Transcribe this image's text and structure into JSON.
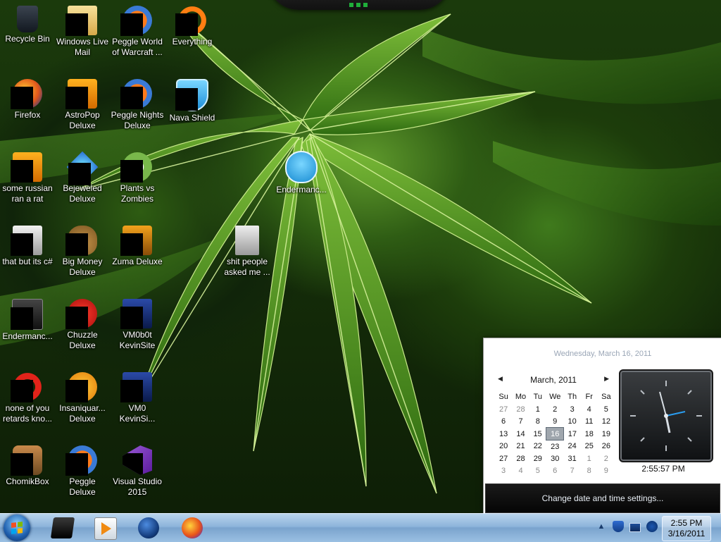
{
  "desktop": {
    "icons": [
      {
        "label": "Recycle Bin",
        "icon": "recycle-bin-icon"
      },
      {
        "label": "Windows Live\nMail",
        "icon": "windows-live-mail-icon"
      },
      {
        "label": "Peggle World\nof Warcraft ...",
        "icon": "peggle-wow-icon"
      },
      {
        "label": "Everything",
        "icon": "everything-icon"
      },
      {
        "label": "Firefox",
        "icon": "firefox-icon"
      },
      {
        "label": "AstroPop\nDeluxe",
        "icon": "astropop-icon"
      },
      {
        "label": "Peggle Nights\nDeluxe",
        "icon": "peggle-nights-icon"
      },
      {
        "label": "Nava Shield",
        "icon": "nava-shield-icon"
      },
      {
        "label": "some russian\nran a rat",
        "icon": "text-document-icon"
      },
      {
        "label": "Bejeweled\nDeluxe",
        "icon": "bejeweled-icon"
      },
      {
        "label": "Plants vs\nZombies",
        "icon": "plants-vs-zombies-icon"
      },
      {
        "label": "Endermanc...",
        "icon": "enderman-shield-icon"
      },
      {
        "label": "that but its c#",
        "icon": "stacked-documents-icon"
      },
      {
        "label": "Big Money\nDeluxe",
        "icon": "big-money-icon"
      },
      {
        "label": "Zuma Deluxe",
        "icon": "zuma-icon"
      },
      {
        "label": "shit people\nasked me ...",
        "icon": "folder-document-icon"
      },
      {
        "label": "Endermanc...",
        "icon": "text-file-icon"
      },
      {
        "label": "Chuzzle\nDeluxe",
        "icon": "chuzzle-icon"
      },
      {
        "label": "VM0b0t\nKevinSite",
        "icon": "vm-site-icon"
      },
      {
        "label": "none of you\nretards kno...",
        "icon": "opera-icon"
      },
      {
        "label": "Insaniquar...\nDeluxe",
        "icon": "insaniquarium-icon"
      },
      {
        "label": "VM0\nKevinSi...",
        "icon": "vm-icon"
      },
      {
        "label": "ChomikBox",
        "icon": "chomikbox-icon"
      },
      {
        "label": "Peggle Deluxe",
        "icon": "peggle-deluxe-icon"
      },
      {
        "label": "Visual Studio\n2015",
        "icon": "visual-studio-icon"
      }
    ]
  },
  "flyout": {
    "long_date": "Wednesday, March 16, 2011",
    "month_label": "March, 2011",
    "prev_icon": "chevron-left-icon",
    "next_icon": "chevron-right-icon",
    "weekdays": [
      "Su",
      "Mo",
      "Tu",
      "We",
      "Th",
      "Fr",
      "Sa"
    ],
    "weeks": [
      [
        {
          "d": "27",
          "o": true
        },
        {
          "d": "28",
          "o": true
        },
        {
          "d": "1"
        },
        {
          "d": "2"
        },
        {
          "d": "3"
        },
        {
          "d": "4"
        },
        {
          "d": "5"
        }
      ],
      [
        {
          "d": "6"
        },
        {
          "d": "7"
        },
        {
          "d": "8"
        },
        {
          "d": "9"
        },
        {
          "d": "10"
        },
        {
          "d": "11"
        },
        {
          "d": "12"
        }
      ],
      [
        {
          "d": "13"
        },
        {
          "d": "14"
        },
        {
          "d": "15"
        },
        {
          "d": "16",
          "today": true
        },
        {
          "d": "17"
        },
        {
          "d": "18"
        },
        {
          "d": "19"
        }
      ],
      [
        {
          "d": "20"
        },
        {
          "d": "21"
        },
        {
          "d": "22"
        },
        {
          "d": "23"
        },
        {
          "d": "24"
        },
        {
          "d": "25"
        },
        {
          "d": "26"
        }
      ],
      [
        {
          "d": "27"
        },
        {
          "d": "28"
        },
        {
          "d": "29"
        },
        {
          "d": "30"
        },
        {
          "d": "31"
        },
        {
          "d": "1",
          "o": true
        },
        {
          "d": "2",
          "o": true
        }
      ],
      [
        {
          "d": "3",
          "o": true
        },
        {
          "d": "4",
          "o": true
        },
        {
          "d": "5",
          "o": true
        },
        {
          "d": "6",
          "o": true
        },
        {
          "d": "7",
          "o": true
        },
        {
          "d": "8",
          "o": true
        },
        {
          "d": "9",
          "o": true
        }
      ]
    ],
    "analog_time": "2:55:57 PM",
    "settings_link": "Change date and time settings..."
  },
  "taskbar": {
    "start_icon": "windows-start-orb-icon",
    "pinned": [
      {
        "icon": "black-box-app-icon"
      },
      {
        "icon": "media-player-icon"
      },
      {
        "icon": "globe-app-icon"
      },
      {
        "icon": "firefox-icon"
      }
    ],
    "tray": {
      "show_hidden_icon": "chevron-up-icon",
      "show_hidden_glyph": "▲",
      "icons": [
        "security-shield-icon",
        "network-icon",
        "volume-icon"
      ]
    },
    "clock": {
      "time": "2:55 PM",
      "date": "3/16/2011"
    }
  },
  "colors": {
    "taskbar": "#8db4db",
    "today_highlight": "#9fa6ad",
    "settings_bar": "#0a0a0a",
    "label_text": "#ffffff"
  }
}
